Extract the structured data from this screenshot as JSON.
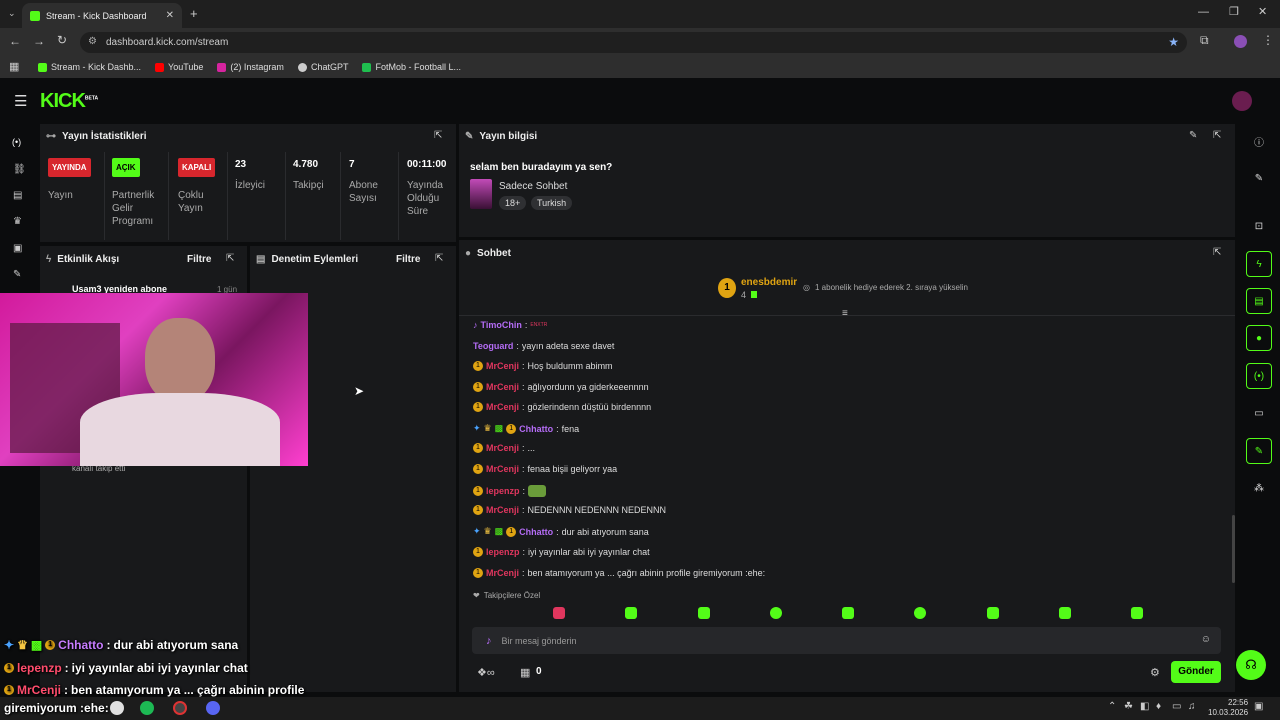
{
  "browser": {
    "tab_title": "Stream - Kick Dashboard",
    "url": "dashboard.kick.com/stream",
    "bookmarks": [
      {
        "label": "Stream - Kick Dashb...",
        "color": "#53fc18"
      },
      {
        "label": "YouTube",
        "color": "#ff0000"
      },
      {
        "label": "(2) Instagram",
        "color": "#d6249f"
      },
      {
        "label": "ChatGPT",
        "color": "#cccccc"
      },
      {
        "label": "FotMob - Football L...",
        "color": "#1fbf4f"
      }
    ]
  },
  "site": {
    "logo": "KICK",
    "logo_tag": "BETA"
  },
  "stats": {
    "title": "Yayın İstatistikleri",
    "items": [
      {
        "badge": "YAYINDA",
        "label": "Yayın"
      },
      {
        "badge": "AÇIK",
        "label": "Partnerlik Gelir Programı"
      },
      {
        "badge": "KAPALI",
        "label": "Çoklu Yayın"
      },
      {
        "value": "23",
        "label": "İzleyici"
      },
      {
        "value": "4.780",
        "label": "Takipçi"
      },
      {
        "value": "7",
        "label": "Abone Sayısı"
      },
      {
        "value": "00:11:00",
        "label": "Yayında Olduğu Süre"
      }
    ]
  },
  "stream_info": {
    "title_label": "Yayın bilgisi",
    "stream_title": "selam ben buradayım ya sen?",
    "category": "Sadece Sohbet",
    "tags": [
      "18+",
      "Turkish"
    ]
  },
  "activity": {
    "title": "Etkinlik Akışı",
    "filter": "Filtre",
    "item_text": "Usam3 yeniden abone",
    "item_time": "1 gün",
    "item2_text": "kanalı takip etti"
  },
  "moderation": {
    "title": "Denetim Eylemleri",
    "filter": "Filtre"
  },
  "chat": {
    "title": "Sohbet",
    "pinned_user": "enesbdemir",
    "pinned_count": "4",
    "pinned_msg": "1 abonelik hediye ederek 2. sıraya yükselin",
    "lines": [
      {
        "user": "TimoChin",
        "color": "#b46cf5",
        "msg": ""
      },
      {
        "user": "Teoguard",
        "color": "#b46cf5",
        "msg": "yayın adeta sexe davet"
      },
      {
        "user": "MrCenji",
        "color": "#e0365e",
        "msg": "Hoş buldumm abimm"
      },
      {
        "user": "MrCenji",
        "color": "#e0365e",
        "msg": "ağlıyordunn ya giderkeeennnn"
      },
      {
        "user": "MrCenji",
        "color": "#e0365e",
        "msg": "gözlerindenn düştüü birdennnn"
      },
      {
        "user": "Chhatto",
        "color": "#b46cf5",
        "msg": "fena"
      },
      {
        "user": "MrCenji",
        "color": "#e0365e",
        "msg": "..."
      },
      {
        "user": "MrCenji",
        "color": "#e0365e",
        "msg": "fenaa bişii geliyorr yaa"
      },
      {
        "user": "lepenzp",
        "color": "#e0365e",
        "msg": ""
      },
      {
        "user": "MrCenji",
        "color": "#e0365e",
        "msg": "NEDENNN NEDENNN NEDENNN"
      },
      {
        "user": "Chhatto",
        "color": "#b46cf5",
        "msg": "dur abi atıyorum sana"
      },
      {
        "user": "lepenzp",
        "color": "#e0365e",
        "msg": "iyi yayınlar abi iyi yayınlar chat"
      },
      {
        "user": "MrCenji",
        "color": "#e0365e",
        "msg": "ben atamıyorum ya ... çağrı abinin profile giremiyorum :ehe:"
      }
    ],
    "followers_only": "Takipçilere Özel",
    "input_placeholder": "Bir mesaj gönderin",
    "points": "0",
    "send": "Gönder"
  },
  "overlay": [
    {
      "user": "Chhatto",
      "color": "#c77dff",
      "msg": "dur abi atıyorum sana"
    },
    {
      "user": "lepenzp",
      "color": "#ff4d6d",
      "msg": "iyi yayınlar abi iyi yayınlar chat"
    },
    {
      "user": "MrCenji",
      "color": "#ff4d6d",
      "msg": "ben atamıyorum ya ... çağrı abinin profile"
    },
    {
      "user": "",
      "color": "#ffffff",
      "msg": "giremiyorum :ehe:"
    }
  ],
  "taskbar": {
    "time": "22:56",
    "date": "10.03.2026"
  }
}
